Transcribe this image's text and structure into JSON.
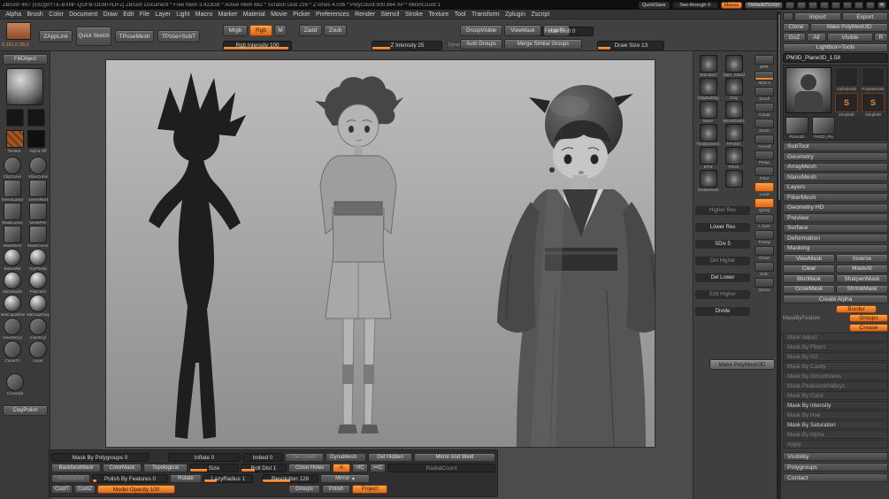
{
  "icons": {
    "close": "✕",
    "dropdown": "▾"
  },
  "titlebar": {
    "title": "ZBrush 4R7 (x32)[BYTE-BXNF-QOFB-OEMI-NJFZ]   ZBrush Document   * Free Mem 3.413GB * Active Mem 682 * Scratch Disk 216 * ZTimes 4.036 * PolyCount:900.864 XP * MeshCount:1",
    "quicksave": "QuickSave",
    "seethrough": "See-through 0",
    "menus_btn": "Menus",
    "zscript_btn": "DefaultZScript"
  },
  "menubar": {
    "items": [
      "Alpha",
      "Brush",
      "Color",
      "Document",
      "Draw",
      "Edit",
      "File",
      "Layer",
      "Light",
      "Macro",
      "Marker",
      "Material",
      "Movie",
      "Picker",
      "Preferences",
      "Render",
      "Stencil",
      "Stroke",
      "Texture",
      "Tool",
      "Transform",
      "Zplugin",
      "Zscript"
    ]
  },
  "shelf": {
    "coords": "0.161,0.28,0",
    "zapplink": "ZAppLink",
    "quick_sketch": "Quick Sketch",
    "tpose_mesh": "TPoseMesh",
    "tpose_subt": "TPose>SubT",
    "mrgb": "Mrgb",
    "rgb": "Rgb",
    "m": "M",
    "rgb_intensity": "Rgb Intensity 100",
    "zadd": "Zadd",
    "zsub": "Zsub",
    "z_intensity": "Z Intensity 25",
    "focal_shift": "Focal Shift 0",
    "draw_size": "Draw Size 13",
    "dynamic": "Dynamic",
    "group_visible": "GroupVisible",
    "viewmask": "ViewMask",
    "hidept": "HidePt",
    "auto_groups": "Auto Groups",
    "merge_similar": "Merge Similar Groups"
  },
  "left_tray": {
    "fill_object": "FillObject",
    "texture_label": "Texture",
    "alpha_label": "Alpha Off",
    "pairs": [
      {
        "a": "ClipCurve",
        "b": "SliceCurve",
        "shape": "circle"
      },
      {
        "a": "SelectLasso",
        "b": "SelectRect",
        "shape": "square"
      },
      {
        "a": "MaskLasso",
        "b": "MaskPen",
        "shape": "square"
      },
      {
        "a": "MaskRect",
        "b": "MaskCurve",
        "shape": "square"
      },
      {
        "a": "BasicMat",
        "b": "ToyPlastic",
        "shape": "sphere"
      },
      {
        "a": "SkinShade",
        "b": "FlatColor",
        "shape": "sphere"
      },
      {
        "a": "MatCapWhite",
        "b": "MatCapGray",
        "shape": "sphere"
      },
      {
        "a": "InsertHCyl",
        "b": "InsertCyl",
        "shape": "circle"
      },
      {
        "a": "CurveTri",
        "b": "Layer",
        "shape": "circle"
      }
    ],
    "single": "CurveQd",
    "clay_polish": "ClayPolish"
  },
  "right_shelf": {
    "brush_pairs": [
      {
        "a": "Standard",
        "b": "Dam_Stand"
      },
      {
        "a": "ClayBuildup",
        "b": "Clay"
      },
      {
        "a": "Move",
        "b": "MoveElastic"
      },
      {
        "a": "TrimDynamic",
        "b": "hPolish"
      },
      {
        "a": "bPnt",
        "b": "Pinch"
      },
      {
        "a": "SnakeHook",
        "b": ""
      }
    ],
    "geo": [
      {
        "l": "Higher Res",
        "cls": "dim"
      },
      {
        "l": "Lower Res",
        "cls": ""
      },
      {
        "l": "SDiv 5",
        "cls": ""
      },
      {
        "l": "Del Higher",
        "cls": "dim"
      },
      {
        "l": "Del Lower",
        "cls": ""
      },
      {
        "l": "Edit Higher",
        "cls": "dim"
      },
      {
        "l": "Divide",
        "cls": ""
      }
    ],
    "make_polymesh": "Make PolyMesh3D",
    "tray_icons": [
      {
        "l": "BPR",
        "cls": ""
      },
      {
        "l": "SDiv 3",
        "cls": "uline"
      },
      {
        "l": "Scroll",
        "cls": ""
      },
      {
        "l": "Actual",
        "cls": ""
      },
      {
        "l": "Zoom",
        "cls": ""
      },
      {
        "l": "AAHalf",
        "cls": ""
      },
      {
        "l": "Persp",
        "cls": ""
      },
      {
        "l": "Floor",
        "cls": ""
      },
      {
        "l": "Local",
        "cls": "on"
      },
      {
        "l": "QGrid",
        "cls": "on"
      },
      {
        "l": "L.Sym",
        "cls": ""
      },
      {
        "l": "Transp",
        "cls": ""
      },
      {
        "l": "Ghost",
        "cls": ""
      },
      {
        "l": "Solo",
        "cls": ""
      },
      {
        "l": "Xpose",
        "cls": ""
      }
    ]
  },
  "tool_palette": {
    "import": "Import",
    "export": "Export",
    "clone": "Clone",
    "make_polymesh": "Make PolyMesh3D",
    "goz": "GoZ",
    "all": "All",
    "visible": "Visible",
    "r": "R",
    "lightbox": "Lightbox>Tools",
    "tool_name": "PM3D_Plane3D_1.58",
    "thumbs": [
      {
        "l": "Cylinder3D",
        "g": ""
      },
      {
        "l": "PolyMesh3D",
        "g": ""
      },
      {
        "l": "SimpleBr",
        "g": "S"
      },
      {
        "l": "SimpleBr",
        "g": "S"
      },
      {
        "l": "Plane3D",
        "g": ""
      },
      {
        "l": "PM3D_Pla",
        "g": ""
      }
    ],
    "sections": [
      "SubTool",
      "Geometry",
      "ArrayMesh",
      "NanoMesh",
      "Layers",
      "FiberMesh",
      "Geometry HD",
      "Preview",
      "Surface",
      "Deformation",
      "Masking"
    ],
    "mask_rows": [
      {
        "a": "ViewMask",
        "b": "Inverse"
      },
      {
        "a": "Clear",
        "b": "MaskAll"
      },
      {
        "a": "BlurMask",
        "b": "SharpenMask"
      },
      {
        "a": "GrowMask",
        "b": "ShrinkMask"
      }
    ],
    "create_alpha": "Create Alpha",
    "border": "Border",
    "mask_by_feature": "MaskByFeature",
    "groups": "Groups",
    "crease": "Crease",
    "mask_list": [
      {
        "l": "Mask Adjust",
        "cls": "dim"
      },
      {
        "l": "Mask By Fibers",
        "cls": "dim"
      },
      {
        "l": "Mask By AO",
        "cls": "dim"
      },
      {
        "l": "Mask By Cavity",
        "cls": "dim"
      },
      {
        "l": "Mask By Smoothness",
        "cls": "dim"
      },
      {
        "l": "Mask PeaksAndValleys",
        "cls": "dim"
      },
      {
        "l": "Mask By Color",
        "cls": "dim"
      },
      {
        "l": "Mask By Intensity",
        "cls": ""
      },
      {
        "l": "Mask By Hue",
        "cls": "dim"
      },
      {
        "l": "Mask By Saturation",
        "cls": ""
      },
      {
        "l": "Mask By Alpha",
        "cls": "dim"
      },
      {
        "l": "Apply",
        "cls": "dim"
      }
    ],
    "bottom_sections": [
      "Visibility",
      "Polygroups",
      "Contact"
    ]
  },
  "bottom_panels": {
    "mask_by_polygroups": "Mask By Polygroups 0",
    "inflate": "Inflate 0",
    "imbed": "Imbed 0",
    "del_lower": "Del Lower",
    "dynamesh": "DynaMesh",
    "del_hidden": "Del Hidden",
    "mirror_and_weld": "Mirror And Weld",
    "backfacemask": "BackfaceMask",
    "colormask": "ColorMask",
    "topological": "Topological",
    "size": "Size",
    "roll_dist": "Roll Dist 1",
    "close_holes": "Close Holes",
    "sym_x": "-X-",
    "fc1": ">fC",
    "fc2": "><C",
    "radial_count": "RadialCount",
    "accucurve": "AccuCurve",
    "polish_by_features": "Polish By Features 0",
    "rotate": "Rotate",
    "lazy_radius": "LazyRadius 1",
    "resolution": "Resolution 128",
    "mirror": "Mirror",
    "cust1": "CustT",
    "cust2": "CustZ",
    "model_opacity": "Model Opacity 100",
    "groups": "Groups",
    "polish": "Polish",
    "project": "Project"
  }
}
